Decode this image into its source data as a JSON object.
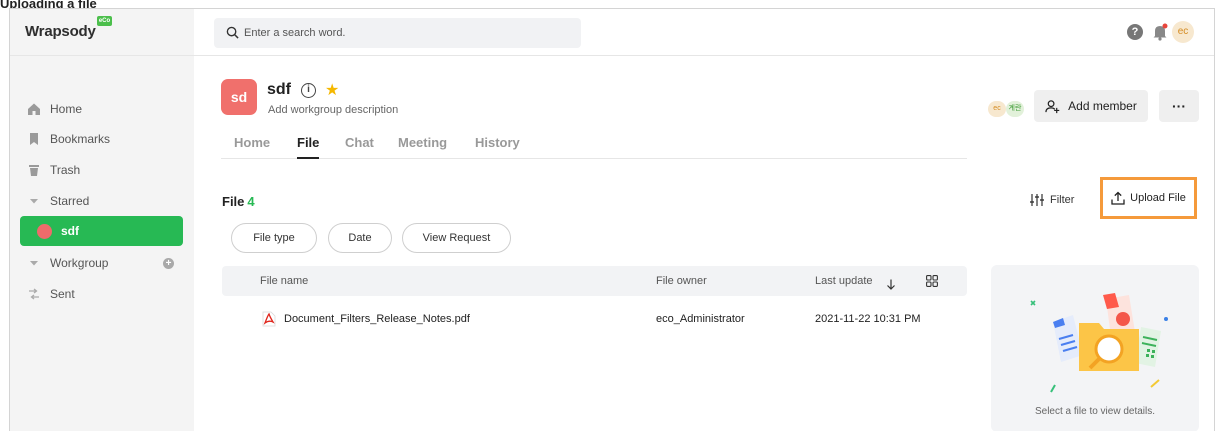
{
  "page_caption": "Uploading a file",
  "brand": {
    "name": "Wrapsody",
    "badge": "eCo"
  },
  "search": {
    "placeholder": "Enter a search word."
  },
  "header": {
    "help_glyph": "?",
    "user_initials": "ec"
  },
  "sidebar": {
    "items": [
      {
        "label": "Home",
        "icon": "home-icon"
      },
      {
        "label": "Bookmarks",
        "icon": "bookmark-icon"
      },
      {
        "label": "Trash",
        "icon": "trash-icon"
      },
      {
        "label": "Starred",
        "icon": "caret-down-icon"
      },
      {
        "label": "sdf",
        "icon": "workgroup-dot-icon",
        "active": true,
        "color": "#ef6b6b"
      },
      {
        "label": "Workgroup",
        "icon": "caret-down-icon"
      },
      {
        "label": "Sent",
        "icon": "sent-icon"
      }
    ],
    "add_glyph": "+",
    "active_color": "#27b954"
  },
  "workgroup": {
    "avatar": "sd",
    "avatar_color": "#f0706c",
    "name": "sdf",
    "description": "Add workgroup description",
    "members": [
      "ec",
      "계란"
    ]
  },
  "actions": {
    "add_member": "Add member",
    "more": "···"
  },
  "tabs": [
    {
      "label": "Home",
      "active": false
    },
    {
      "label": "File",
      "active": true
    },
    {
      "label": "Chat",
      "active": false
    },
    {
      "label": "Meeting",
      "active": false
    },
    {
      "label": "History",
      "active": false
    }
  ],
  "file_section": {
    "title": "File",
    "count": "4",
    "filter_label": "Filter",
    "upload_label": "Upload File",
    "chips": [
      "File type",
      "Date",
      "View Request"
    ]
  },
  "table": {
    "columns": [
      "File name",
      "File owner",
      "Last update"
    ],
    "rows": [
      {
        "name": "Document_Filters_Release_Notes.pdf",
        "owner": "eco_Administrator",
        "updated": "2021-11-22 10:31 PM"
      }
    ]
  },
  "details": {
    "empty_text": "Select a file to view details."
  },
  "colors": {
    "accent": "#27b954",
    "highlight": "#f59a3b"
  }
}
